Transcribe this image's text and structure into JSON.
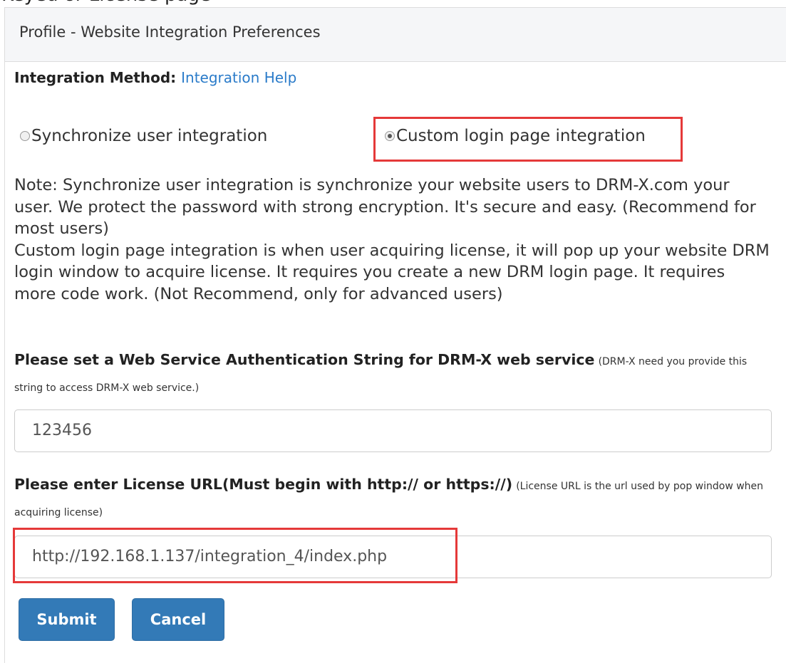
{
  "header": {
    "partial_text": "Keyed or License page",
    "panel_title": "Profile - Website Integration Preferences"
  },
  "integration": {
    "label": "Integration Method:",
    "help_link": "Integration Help",
    "options": [
      {
        "label": "Synchronize user integration",
        "checked": false
      },
      {
        "label": "Custom login page integration",
        "checked": true
      }
    ]
  },
  "note": "Note: Synchronize user integration is synchronize your website users to DRM-X.com your user. We protect the password with strong encryption. It's secure and easy. (Recommend for most users)\nCustom login page integration is when user acquiring license, it will pop up your website DRM login window to acquire license. It requires you create a new DRM login page. It requires more code work. (Not Recommend, only for advanced users)",
  "auth": {
    "label": "Please set a Web Service Authentication String for DRM-X web service",
    "hint": "(DRM-X need you provide this string to access DRM-X web service.)",
    "value": "123456"
  },
  "license": {
    "label": "Please enter License URL(Must begin with http:// or https://)",
    "hint": "(License URL is the url used by pop window when acquiring license)",
    "value": "http://192.168.1.137/integration_4/index.php"
  },
  "buttons": {
    "submit": "Submit",
    "cancel": "Cancel"
  },
  "colors": {
    "highlight": "#e53939",
    "primary": "#337ab7",
    "link": "#2a7bc9"
  }
}
